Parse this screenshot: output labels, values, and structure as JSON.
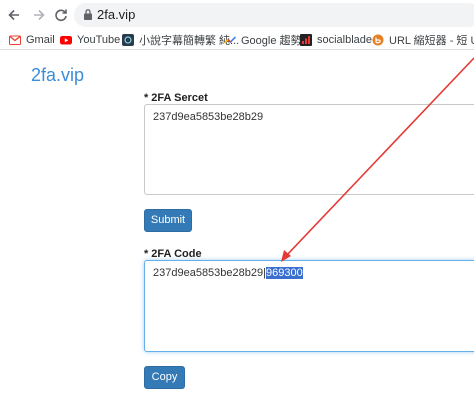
{
  "browser": {
    "url": "2fa.vip",
    "bookmarks": [
      {
        "label": "Gmail",
        "icon": "gmail-icon"
      },
      {
        "label": "YouTube",
        "icon": "youtube-icon"
      },
      {
        "label": "小說字幕簡轉繁 純...",
        "icon": "subtitle-site-icon"
      },
      {
        "label": "Google 趨勢",
        "icon": "google-trends-icon"
      },
      {
        "label": "socialblade",
        "icon": "socialblade-icon"
      },
      {
        "label": "URL 縮短器 - 短 U...",
        "icon": "url-shortener-icon"
      }
    ]
  },
  "page": {
    "title": "2fa.vip",
    "secret": {
      "required_mark": "*",
      "label": "2FA Sercet",
      "value": "237d9ea5853be28b29"
    },
    "submit_label": "Submit",
    "code": {
      "required_mark": "*",
      "label": "2FA Code",
      "value_prefix": "237d9ea5853be28b29|",
      "value_selected": "969300"
    },
    "copy_label": "Copy"
  },
  "colors": {
    "accent": "#3c8dd8",
    "button": "#337ab7",
    "selection": "#3a6fd0",
    "annotation_arrow": "#e53935"
  }
}
